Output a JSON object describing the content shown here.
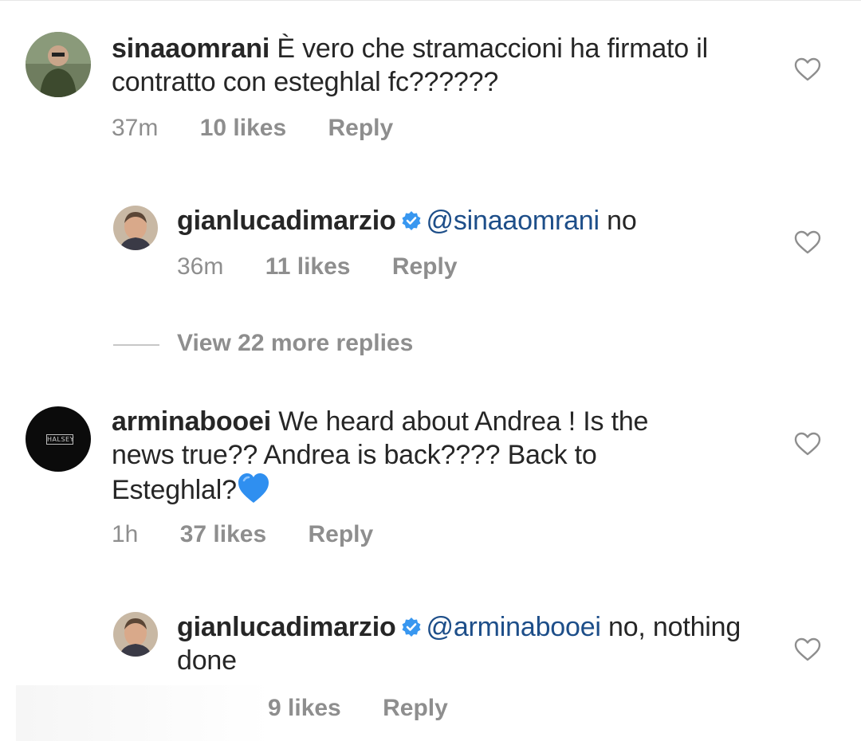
{
  "comments": [
    {
      "username": "sinaaomrani",
      "text": "È vero che stramaccioni ha firmato il contratto con esteghlal fc??????",
      "time": "37m",
      "likes": "10 likes",
      "reply_label": "Reply",
      "replies": [
        {
          "username": "gianlucadimarzio",
          "mention": "@sinaaomrani",
          "text": " no",
          "time": "36m",
          "likes": "11 likes",
          "reply_label": "Reply"
        }
      ],
      "view_more": "View 22 more replies"
    },
    {
      "username": "arminabooei",
      "text": "We heard about Andrea ! Is the news true?? Andrea is back???? Back to Esteghlal?",
      "emoji": "blue-heart-icon",
      "avatar_text": "HALSEY",
      "time": "1h",
      "likes": "37 likes",
      "reply_label": "Reply",
      "replies": [
        {
          "username": "gianlucadimarzio",
          "mention": "@arminabooei",
          "text": " no, nothing done",
          "likes": "9 likes",
          "reply_label": "Reply"
        }
      ]
    }
  ],
  "colors": {
    "text": "#262626",
    "meta": "#8e8e8e",
    "mention": "#1d4e89",
    "verified": "#3897f0",
    "heart_blue": "#2f8ff0"
  },
  "icons": [
    "heart-outline-icon",
    "verified-badge-icon",
    "blue-heart-icon"
  ]
}
